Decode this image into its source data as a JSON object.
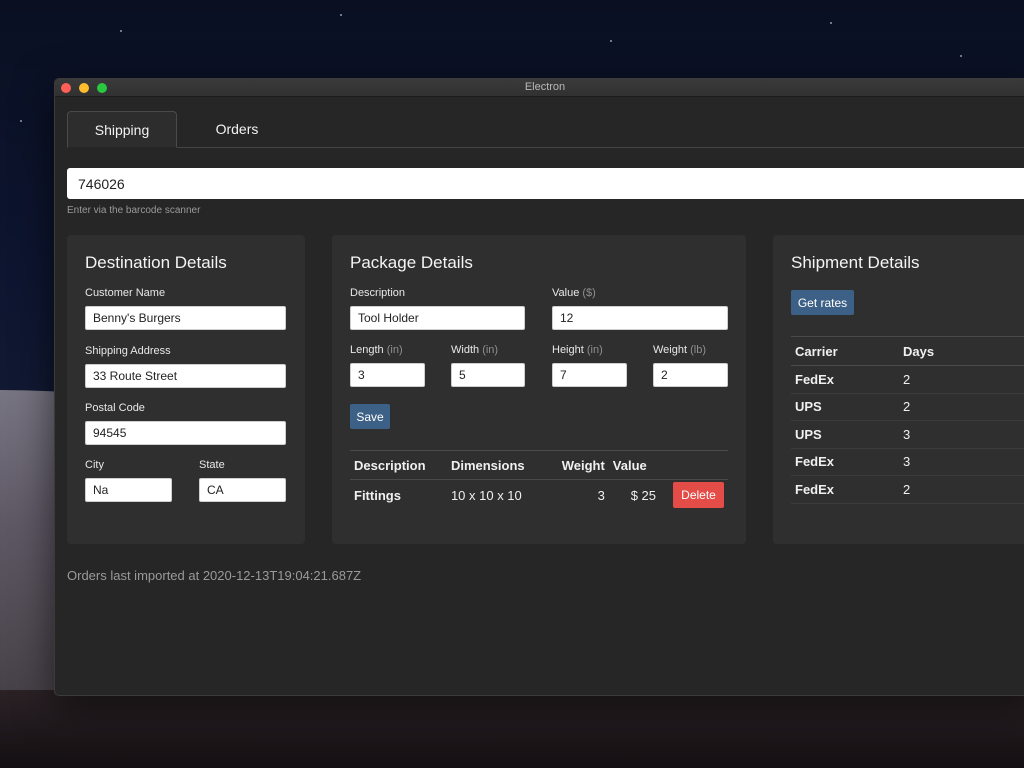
{
  "window": {
    "title": "Electron"
  },
  "tabs": [
    {
      "label": "Shipping",
      "active": true
    },
    {
      "label": "Orders",
      "active": false
    }
  ],
  "barcode": {
    "value": "746026",
    "hint": "Enter via the barcode scanner"
  },
  "destination": {
    "title": "Destination Details",
    "customer_name_label": "Customer Name",
    "customer_name": "Benny's Burgers",
    "address_label": "Shipping Address",
    "address": "33 Route Street",
    "postal_label": "Postal Code",
    "postal": "94545",
    "city_label": "City",
    "city": "Na",
    "state_label": "State",
    "state": "CA"
  },
  "package": {
    "title": "Package Details",
    "description_label": "Description",
    "description": "Tool Holder",
    "value_label": "Value",
    "value_unit": "($)",
    "value": "12",
    "length_label": "Length",
    "length_unit": "(in)",
    "length": "3",
    "width_label": "Width",
    "width_unit": "(in)",
    "width": "5",
    "height_label": "Height",
    "height_unit": "(in)",
    "height": "7",
    "weight_label": "Weight",
    "weight_unit": "(lb)",
    "weight": "2",
    "save_label": "Save",
    "table_headers": [
      "Description",
      "Dimensions",
      "Weight",
      "Value"
    ],
    "rows": [
      {
        "description": "Fittings",
        "dimensions": "10 x 10 x 10",
        "weight": "3",
        "value": "$ 25",
        "delete_label": "Delete"
      }
    ]
  },
  "shipment": {
    "title": "Shipment Details",
    "get_rates_label": "Get rates",
    "table_headers": [
      "Carrier",
      "Days"
    ],
    "rows": [
      {
        "carrier": "FedEx",
        "days": "2"
      },
      {
        "carrier": "UPS",
        "days": "2"
      },
      {
        "carrier": "UPS",
        "days": "3"
      },
      {
        "carrier": "FedEx",
        "days": "3"
      },
      {
        "carrier": "FedEx",
        "days": "2"
      }
    ]
  },
  "footer": {
    "imported_text": "Orders last imported at 2020-12-13T19:04:21.687Z"
  },
  "colors": {
    "accent_blue": "#3d6186",
    "delete_red": "#e44d47",
    "panel": "#2f2f2f",
    "window_bg": "#262626"
  }
}
